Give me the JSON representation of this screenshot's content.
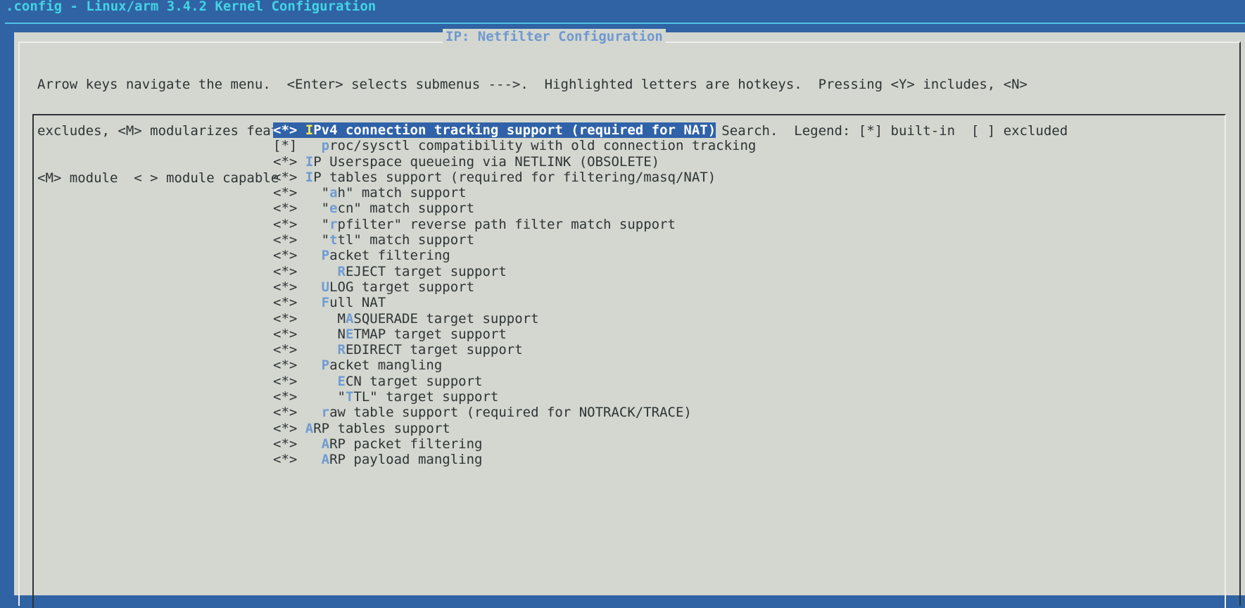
{
  "window": {
    "title": ".config - Linux/arm 3.4.2 Kernel Configuration"
  },
  "dialog": {
    "title": "IP: Netfilter Configuration",
    "help_lines": [
      "Arrow keys navigate the menu.  <Enter> selects submenus --->.  Highlighted letters are hotkeys.  Pressing <Y> includes, <N>",
      "excludes, <M> modularizes features.  Press <Esc><Esc> to exit, <?> for Help, </> for Search.  Legend: [*] built-in  [ ] excluded",
      "<M> module  < > module capable"
    ]
  },
  "colors": {
    "background": "#3063a3",
    "dialog": "#d3d7cf",
    "selection": "#2f62a8",
    "hotkey": "#6f9bd3",
    "selected_hotkey": "#fce94f"
  },
  "menu": {
    "items": [
      {
        "mark": "<*>",
        "pre": " ",
        "key": "I",
        "post": "Pv4 connection tracking support (required for NAT)",
        "selected": true
      },
      {
        "mark": "[*]",
        "pre": "   ",
        "key": "p",
        "post": "roc/sysctl compatibility with old connection tracking"
      },
      {
        "mark": "<*>",
        "pre": " ",
        "key": "I",
        "post": "P Userspace queueing via NETLINK (OBSOLETE)"
      },
      {
        "mark": "<*>",
        "pre": " ",
        "key": "I",
        "post": "P tables support (required for filtering/masq/NAT)"
      },
      {
        "mark": "<*>",
        "pre": "   \"",
        "key": "a",
        "post": "h\" match support"
      },
      {
        "mark": "<*>",
        "pre": "   \"",
        "key": "e",
        "post": "cn\" match support"
      },
      {
        "mark": "<*>",
        "pre": "   \"",
        "key": "r",
        "post": "pfilter\" reverse path filter match support"
      },
      {
        "mark": "<*>",
        "pre": "   \"",
        "key": "t",
        "post": "tl\" match support"
      },
      {
        "mark": "<*>",
        "pre": "   ",
        "key": "P",
        "post": "acket filtering"
      },
      {
        "mark": "<*>",
        "pre": "     ",
        "key": "R",
        "post": "EJECT target support"
      },
      {
        "mark": "<*>",
        "pre": "   ",
        "key": "U",
        "post": "LOG target support"
      },
      {
        "mark": "<*>",
        "pre": "   ",
        "key": "F",
        "post": "ull NAT"
      },
      {
        "mark": "<*>",
        "pre": "     M",
        "key": "A",
        "post": "SQUERADE target support"
      },
      {
        "mark": "<*>",
        "pre": "     N",
        "key": "E",
        "post": "TMAP target support"
      },
      {
        "mark": "<*>",
        "pre": "     ",
        "key": "R",
        "post": "EDIRECT target support"
      },
      {
        "mark": "<*>",
        "pre": "   ",
        "key": "P",
        "post": "acket mangling"
      },
      {
        "mark": "<*>",
        "pre": "     ",
        "key": "E",
        "post": "CN target support"
      },
      {
        "mark": "<*>",
        "pre": "     \"",
        "key": "T",
        "post": "TL\" target support"
      },
      {
        "mark": "<*>",
        "pre": "   ",
        "key": "r",
        "post": "aw table support (required for NOTRACK/TRACE)"
      },
      {
        "mark": "<*>",
        "pre": " ",
        "key": "A",
        "post": "RP tables support"
      },
      {
        "mark": "<*>",
        "pre": "   ",
        "key": "A",
        "post": "RP packet filtering"
      },
      {
        "mark": "<*>",
        "pre": "   ",
        "key": "A",
        "post": "RP payload mangling"
      }
    ]
  }
}
